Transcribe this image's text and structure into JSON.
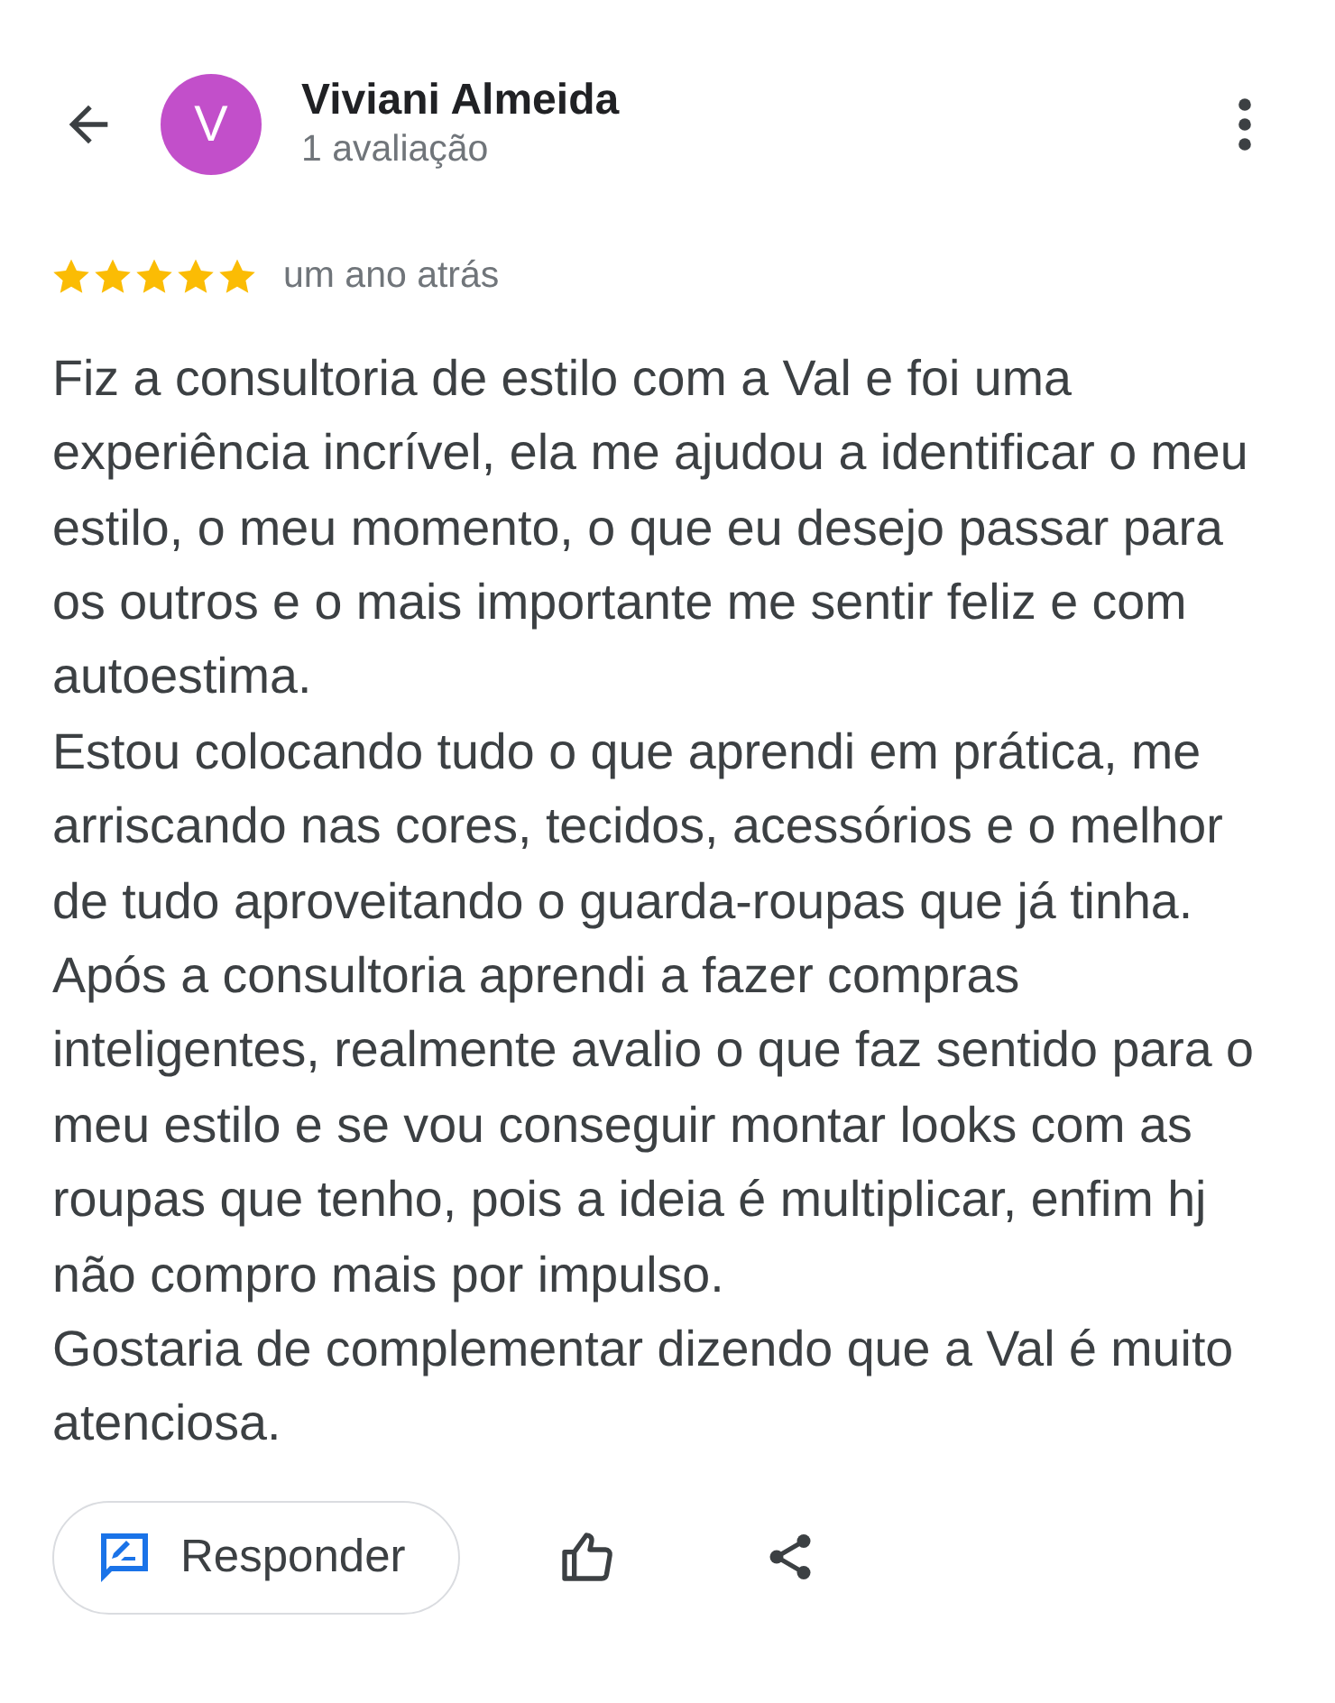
{
  "reviewer": {
    "initial": "V",
    "name": "Viviani Almeida",
    "review_count": "1 avaliação"
  },
  "review": {
    "stars": 5,
    "time": "um ano atrás",
    "paragraphs": [
      "Fiz a consultoria de estilo com a Val e foi uma experiência incrível, ela me ajudou a identificar o meu estilo, o meu momento, o que eu desejo passar para os outros e o mais importante me sentir feliz e com autoestima.",
      "Estou colocando tudo o que aprendi em prática, me arriscando nas cores, tecidos, acessórios e o melhor de tudo aproveitando o guarda-roupas que já tinha.",
      "Após a consultoria aprendi a fazer compras inteligentes, realmente avalio o que faz sentido para o meu estilo e se vou conseguir montar looks com as roupas que tenho, pois a ideia é multiplicar, enfim hj não compro mais por impulso.",
      "Gostaria de complementar dizendo que a Val é muito atenciosa."
    ]
  },
  "actions": {
    "reply_label": "Responder"
  }
}
